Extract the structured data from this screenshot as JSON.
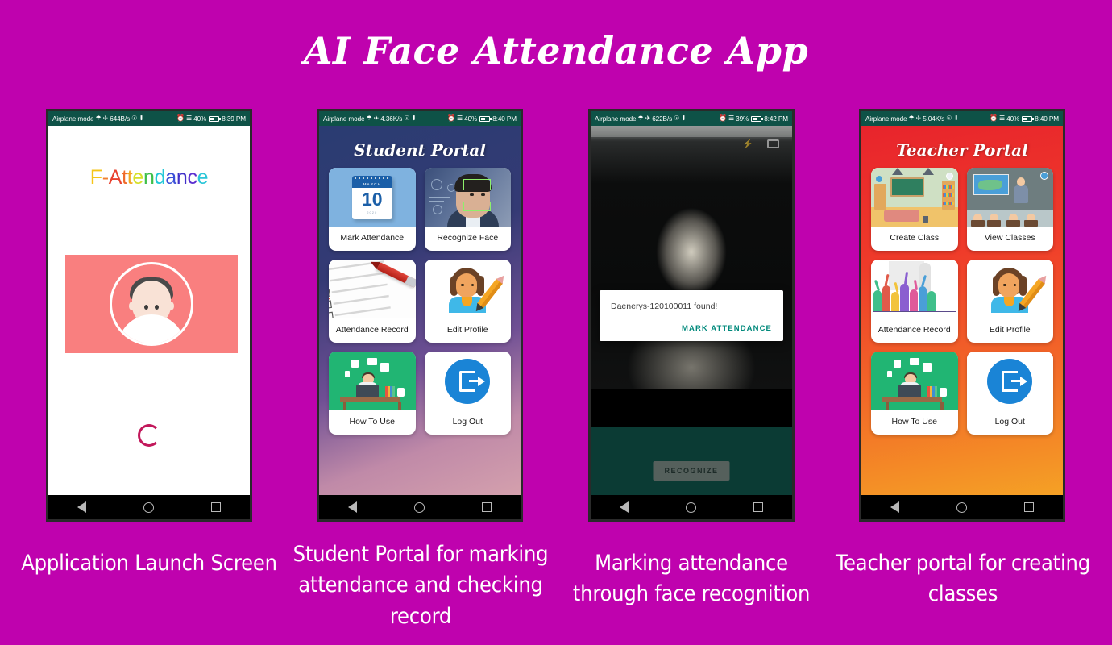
{
  "poster": {
    "title": "AI Face Attendance App",
    "background_color": "#BF02AE",
    "title_color": "#FFFFFF"
  },
  "phones": [
    {
      "id": "splash",
      "status_bar": {
        "airplane_label": "Airplane mode",
        "network_speed": "644B/s",
        "battery_percent": "40%",
        "clock": "8:39 PM"
      },
      "brand": {
        "letters": [
          {
            "char": "F",
            "color": "#F5C518"
          },
          {
            "char": "-",
            "color": "#F08030"
          },
          {
            "char": "A",
            "color": "#E8412F"
          },
          {
            "char": "t",
            "color": "#EF6B2B"
          },
          {
            "char": "t",
            "color": "#F2A620"
          },
          {
            "char": "e",
            "color": "#D6E02A"
          },
          {
            "char": "n",
            "color": "#3FBF4A"
          },
          {
            "char": "d",
            "color": "#22C8D8"
          },
          {
            "char": "a",
            "color": "#3A50D8"
          },
          {
            "char": "n",
            "color": "#4030C8"
          },
          {
            "char": "c",
            "color": "#5B2FD0"
          },
          {
            "char": "e",
            "color": "#2CC6D8"
          }
        ],
        "text": "F-Attendance"
      },
      "hero": {
        "background_color": "#F97F7F",
        "icon": "user-avatar-icon"
      },
      "loading": {
        "icon": "loading-spinner-icon",
        "color": "#C2185B"
      },
      "caption": "Application Launch Screen"
    },
    {
      "id": "student-portal",
      "status_bar": {
        "airplane_label": "Airplane mode",
        "network_speed": "4.36K/s",
        "battery_percent": "40%",
        "clock": "8:40 PM"
      },
      "title": "Student Portal",
      "tiles": [
        {
          "label": "Mark Attendance",
          "art": "calendar-icon",
          "calendar": {
            "month": "MARCH",
            "day": "10",
            "year": "2020"
          }
        },
        {
          "label": "Recognize Face",
          "art": "face-scan-icon"
        },
        {
          "label": "Attendance Record",
          "art": "checklist-icon"
        },
        {
          "label": "Edit Profile",
          "art": "person-pencil-icon"
        },
        {
          "label": "How To Use",
          "art": "desk-worker-icon"
        },
        {
          "label": "Log Out",
          "art": "logout-icon"
        }
      ],
      "caption": "Student Portal for marking attendance and checking record"
    },
    {
      "id": "face-recognition",
      "status_bar": {
        "airplane_label": "Airplane mode",
        "network_speed": "622B/s",
        "battery_percent": "39%",
        "clock": "8:42 PM"
      },
      "camera": {
        "flash_icon": "flash-auto-icon",
        "switch_icon": "camera-switch-icon"
      },
      "dialog": {
        "message": "Daenerys-120100011 found!",
        "action_label": "MARK ATTENDANCE",
        "action_color": "#00897B"
      },
      "recognize_button": "RECOGNIZE",
      "caption": "Marking attendance through face recognition"
    },
    {
      "id": "teacher-portal",
      "status_bar": {
        "airplane_label": "Airplane mode",
        "network_speed": "5.04K/s",
        "battery_percent": "40%",
        "clock": "8:40 PM"
      },
      "title": "Teacher Portal",
      "tiles": [
        {
          "label": "Create Class",
          "art": "classroom-icon"
        },
        {
          "label": "View Classes",
          "art": "class-students-icon"
        },
        {
          "label": "Attendance Record",
          "art": "crowd-hands-icon"
        },
        {
          "label": "Edit Profile",
          "art": "person-pencil-icon"
        },
        {
          "label": "How To Use",
          "art": "desk-worker-icon"
        },
        {
          "label": "Log Out",
          "art": "logout-icon"
        }
      ],
      "caption": "Teacher portal for creating classes"
    }
  ],
  "nav_bar": {
    "back_icon": "back-triangle-icon",
    "home_icon": "home-circle-icon",
    "recents_icon": "recents-square-icon"
  }
}
